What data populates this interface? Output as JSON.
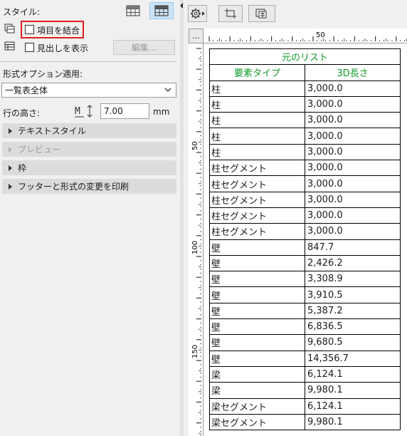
{
  "left_panel": {
    "style_label": "スタイル:",
    "merge_items_label": "項目を結合",
    "show_headings_label": "見出しを表示",
    "edit_button": "編集...",
    "format_option_label": "形式オプション適用:",
    "format_option_value": "一覧表全体",
    "row_height_label": "行の高さ:",
    "row_height_value": "7.00",
    "row_height_unit": "mm",
    "sections": [
      {
        "label": "テキストスタイル",
        "enabled": true
      },
      {
        "label": "プレビュー",
        "enabled": false
      },
      {
        "label": "枠",
        "enabled": true
      },
      {
        "label": "フッターと形式の変更を印刷",
        "enabled": true
      }
    ]
  },
  "right_panel": {
    "corner_button": "...",
    "ruler_top_labels": [
      "50"
    ],
    "ruler_left_labels": [
      "50",
      "100",
      "150"
    ],
    "table": {
      "title": "元のリスト",
      "headers": [
        "要素タイプ",
        "3D長さ"
      ],
      "rows": [
        [
          "柱",
          "3,000.0"
        ],
        [
          "柱",
          "3,000.0"
        ],
        [
          "柱",
          "3,000.0"
        ],
        [
          "柱",
          "3,000.0"
        ],
        [
          "柱",
          "3,000.0"
        ],
        [
          "柱セグメント",
          "3,000.0"
        ],
        [
          "柱セグメント",
          "3,000.0"
        ],
        [
          "柱セグメント",
          "3,000.0"
        ],
        [
          "柱セグメント",
          "3,000.0"
        ],
        [
          "柱セグメント",
          "3,000.0"
        ],
        [
          "壁",
          "847.7"
        ],
        [
          "壁",
          "2,426.2"
        ],
        [
          "壁",
          "3,308.9"
        ],
        [
          "壁",
          "3,910.5"
        ],
        [
          "壁",
          "5,387.2"
        ],
        [
          "壁",
          "6,836.5"
        ],
        [
          "壁",
          "9,680.5"
        ],
        [
          "壁",
          "14,356.7"
        ],
        [
          "梁",
          "6,124.1"
        ],
        [
          "梁",
          "9,980.1"
        ],
        [
          "梁セグメント",
          "6,124.1"
        ],
        [
          "梁セグメント",
          "9,980.1"
        ]
      ]
    }
  },
  "colors": {
    "header_green": "#0f9b2a",
    "highlight_red": "#e02020",
    "selected_blue": "#cce4f7"
  },
  "icons": [
    "grid-style-icon",
    "grid-style-selected-icon",
    "merge-items-icon",
    "headings-icon",
    "row-height-icon",
    "settings-gear-icon",
    "fit-view-icon",
    "zoom-view-icon",
    "collapse-arrow-icon"
  ]
}
